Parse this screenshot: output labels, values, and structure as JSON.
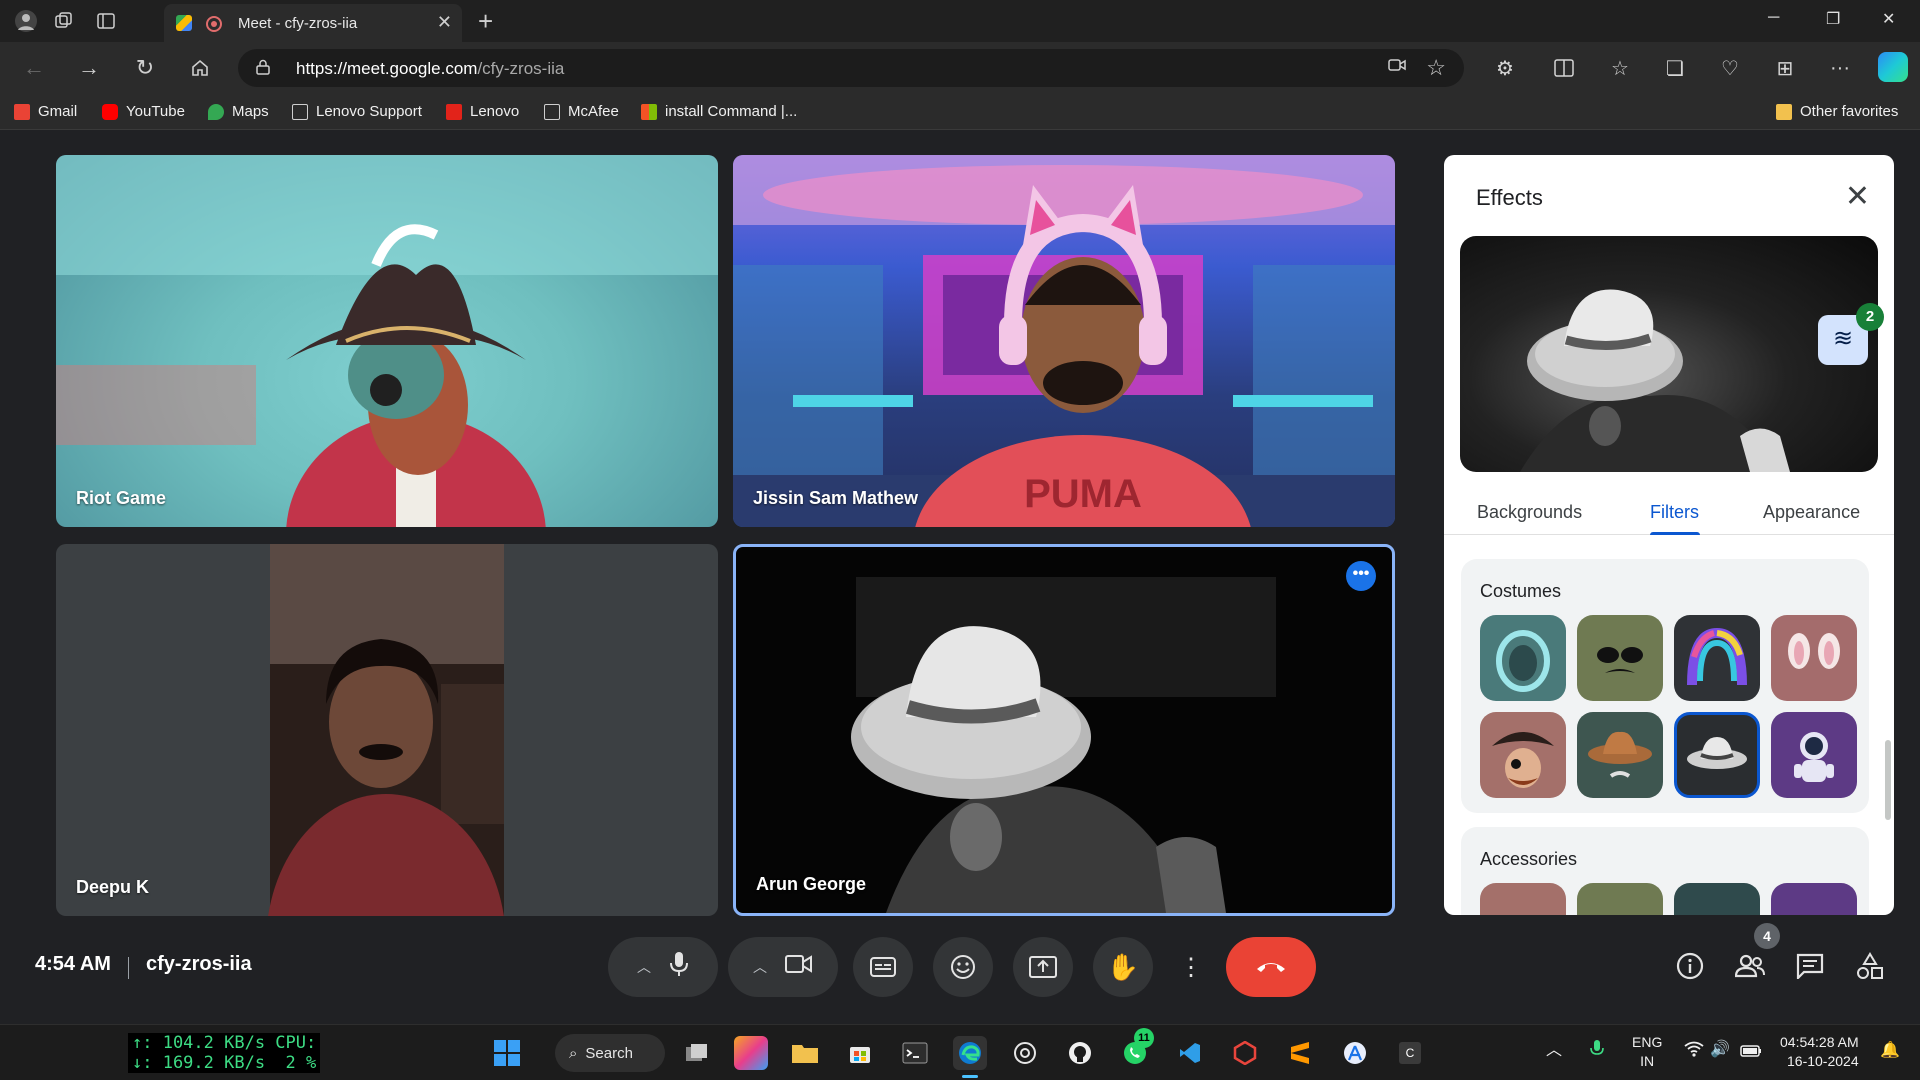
{
  "browser": {
    "tab_title": "Meet - cfy-zros-iia",
    "url_host": "https://meet.google.com",
    "url_path": "/cfy-zros-iia",
    "favorites": [
      {
        "label": "Gmail",
        "color": "#ea4335"
      },
      {
        "label": "YouTube",
        "color": "#ff0000"
      },
      {
        "label": "Maps",
        "color": "#34a853"
      },
      {
        "label": "Lenovo Support",
        "color": "#cfcfcf"
      },
      {
        "label": "Lenovo",
        "color": "#e2231a"
      },
      {
        "label": "McAfee",
        "color": "#cfcfcf"
      },
      {
        "label": "install Command |...",
        "color": "#f35325"
      }
    ],
    "other_favorites": "Other favorites"
  },
  "meeting": {
    "participants": [
      {
        "name": "Riot Game"
      },
      {
        "name": "Jissin Sam Mathew"
      },
      {
        "name": "Deepu K"
      },
      {
        "name": "Arun George"
      }
    ],
    "time": "4:54 AM",
    "code": "cfy-zros-iia",
    "people_count": "4"
  },
  "effects_panel": {
    "title": "Effects",
    "layers_count": "2",
    "tabs": [
      "Backgrounds",
      "Filters",
      "Appearance"
    ],
    "active_tab": "Filters",
    "sections": [
      {
        "label": "Costumes"
      },
      {
        "label": "Accessories"
      }
    ],
    "costumes": [
      "diver-helmet",
      "sunglasses-mustache",
      "rainbow-wig",
      "bunny-ears",
      "pirate-hat",
      "cowboy-hat",
      "fedora-hat",
      "astronaut"
    ],
    "selected_costume": "fedora-hat"
  },
  "taskbar": {
    "netmon_line1": "↑: 104.2 KB/s CPU:",
    "netmon_line2": "↓: 169.2 KB/s  2 %",
    "search_label": "Search",
    "whatsapp_badge": "11",
    "lang_line1": "ENG",
    "lang_line2": "IN",
    "clock_time": "04:54:28 AM",
    "clock_date": "16-10-2024"
  },
  "colors": {
    "accent": "#1a73e8",
    "end_call": "#ea4335",
    "selected_border": "#0b57d0"
  }
}
